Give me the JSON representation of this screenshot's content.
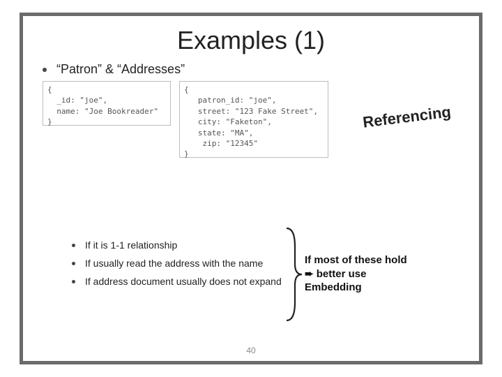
{
  "title": "Examples (1)",
  "intro_bullet": "“Patron” & “Addresses”",
  "annotation": "Referencing",
  "code_left": "{\n  _id: \"joe\",\n  name: \"Joe Bookreader\"\n}",
  "code_right": "{\n   patron_id: \"joe\",\n   street: \"123 Fake Street\",\n   city: \"Faketon\",\n   state: \"MA\",\n    zip: \"12345\"\n}",
  "conditions": {
    "b1": "If it is 1-1 relationship",
    "b2": "If usually read the address with the name",
    "b3": "If address document usually does not expand"
  },
  "conclusion": {
    "line1": "If most of these hold",
    "arrow": "➨",
    "line2_rest": " better use",
    "line3": "Embedding"
  },
  "page_number": "40"
}
